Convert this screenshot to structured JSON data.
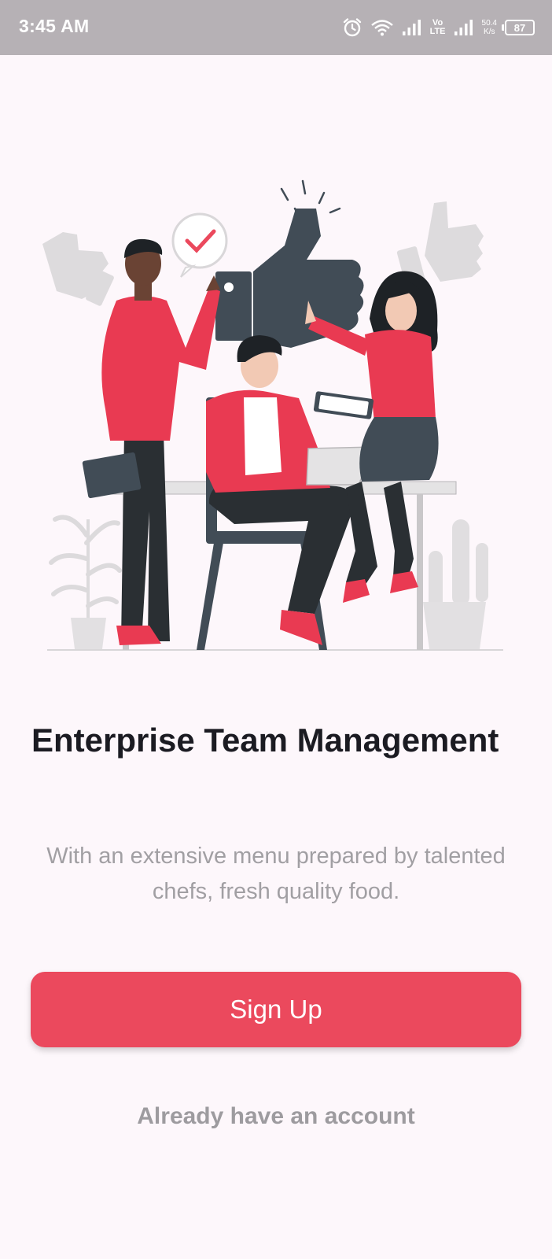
{
  "status_bar": {
    "time": "3:45 AM",
    "network_label_top": "Vo",
    "network_label_bottom": "LTE",
    "speed_value": "50.4",
    "speed_unit": "K/s",
    "battery_level": "87"
  },
  "onboarding": {
    "title": "Enterprise Team Management",
    "subtitle": "With an extensive menu prepared by talented chefs, fresh quality food.",
    "signup_label": "Sign Up",
    "login_label": "Already have an account"
  },
  "colors": {
    "accent": "#EB495D",
    "background": "#FDF7FB",
    "status_bar": "#B6B1B5",
    "title_text": "#1B1B22",
    "muted_text": "#A19FA3"
  },
  "icons": [
    "alarm-icon",
    "wifi-icon",
    "signal-icon",
    "battery-icon"
  ]
}
